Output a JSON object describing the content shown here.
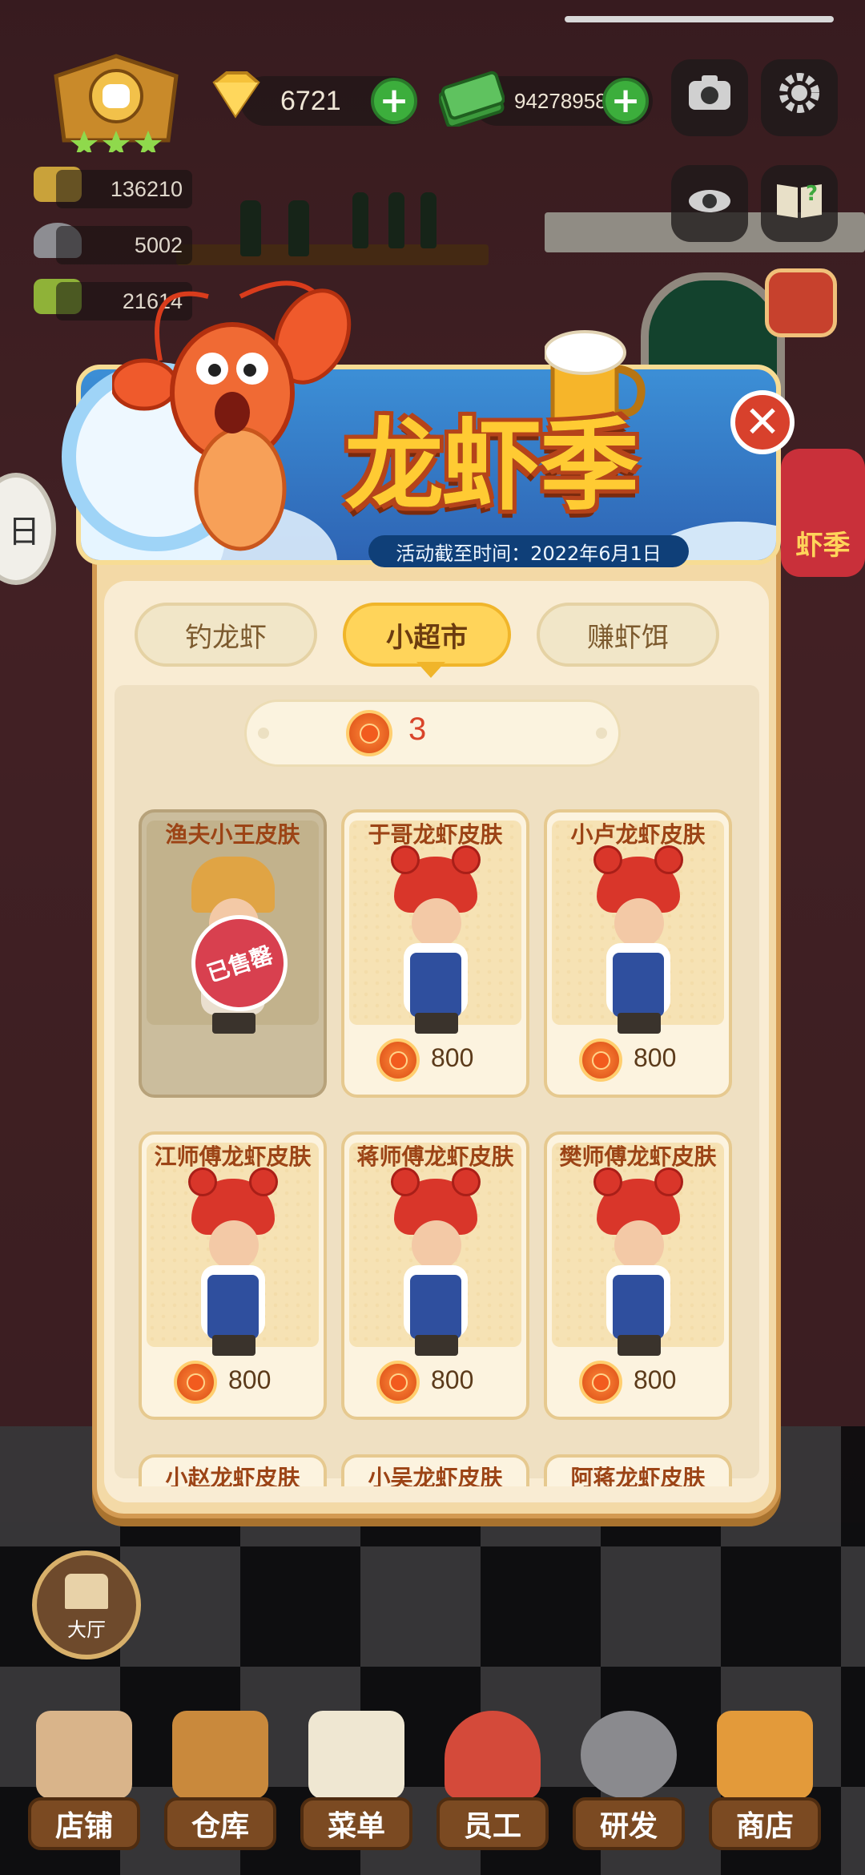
{
  "hud": {
    "gems": "6721",
    "cash": "94278958",
    "stats": [
      "136210",
      "5002",
      "21614"
    ]
  },
  "event": {
    "title": "龙虾季",
    "deadline": "活动截至时间：2022年6月1日",
    "side_label": "虾季"
  },
  "tabs": [
    {
      "label": "钓龙虾",
      "active": false
    },
    {
      "label": "小超市",
      "active": true
    },
    {
      "label": "赚虾饵",
      "active": false
    }
  ],
  "currency": {
    "balance": "3"
  },
  "shop": {
    "items": [
      {
        "name": "渔夫小王皮肤",
        "price": "",
        "status": "已售罄"
      },
      {
        "name": "于哥龙虾皮肤",
        "price": "800"
      },
      {
        "name": "小卢龙虾皮肤",
        "price": "800"
      },
      {
        "name": "江师傅龙虾皮肤",
        "price": "800"
      },
      {
        "name": "蒋师傅龙虾皮肤",
        "price": "800"
      },
      {
        "name": "樊师傅龙虾皮肤",
        "price": "800"
      }
    ],
    "peek": [
      "小赵龙虾皮肤",
      "小吴龙虾皮肤",
      "阿蒋龙虾皮肤"
    ]
  },
  "hall": {
    "label": "大厅"
  },
  "nav": [
    {
      "label": "店铺",
      "icon": "shop-icon"
    },
    {
      "label": "仓库",
      "icon": "warehouse-icon"
    },
    {
      "label": "菜单",
      "icon": "menu-icon"
    },
    {
      "label": "员工",
      "icon": "staff-icon"
    },
    {
      "label": "研发",
      "icon": "research-icon"
    },
    {
      "label": "商店",
      "icon": "store-icon"
    }
  ],
  "left_badge": "日"
}
